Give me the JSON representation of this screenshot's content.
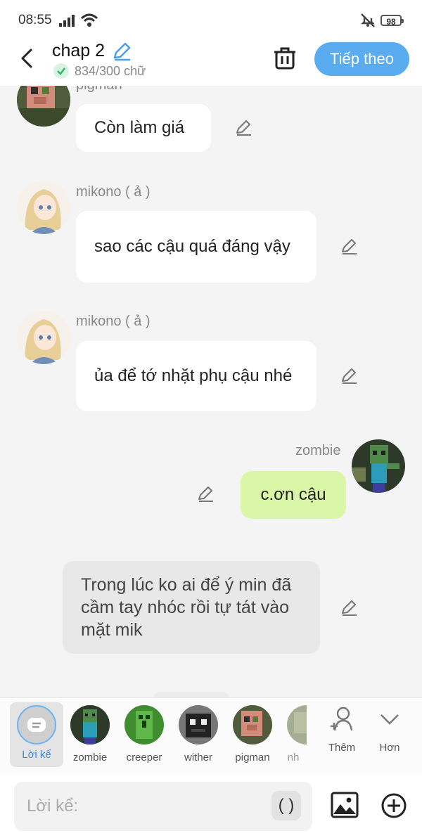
{
  "status": {
    "time": "08:55",
    "battery": "98"
  },
  "header": {
    "title": "chap 2",
    "word_count": "834/300 chữ",
    "next_label": "Tiếp theo"
  },
  "messages": [
    {
      "name": "pigman",
      "text": "Còn làm giá"
    },
    {
      "name": "mikono ( ả )",
      "text": "sao các cậu quá đáng vậy"
    },
    {
      "name": "mikono ( ả )",
      "text": "ủa để tớ nhặt phụ cậu nhé"
    },
    {
      "name": "zombie",
      "text": "c.ơn cậu"
    },
    {
      "name": "",
      "text": "Trong lúc ko ai để ý min đã cầm tay nhóc rồi tự tát vào mặt mik"
    }
  ],
  "characters": [
    {
      "label": "Lời kể"
    },
    {
      "label": "zombie"
    },
    {
      "label": "creeper"
    },
    {
      "label": "wither"
    },
    {
      "label": "pigman"
    },
    {
      "label": "nh"
    }
  ],
  "actions": {
    "add_label": "Thêm",
    "more_label": "Hơn"
  },
  "input": {
    "placeholder": "Lời kể:",
    "paren": "( )"
  },
  "colors": {
    "accent": "#5aacf0",
    "my_bubble": "#d9f7a6",
    "narration_bubble": "#e8e8e8"
  }
}
